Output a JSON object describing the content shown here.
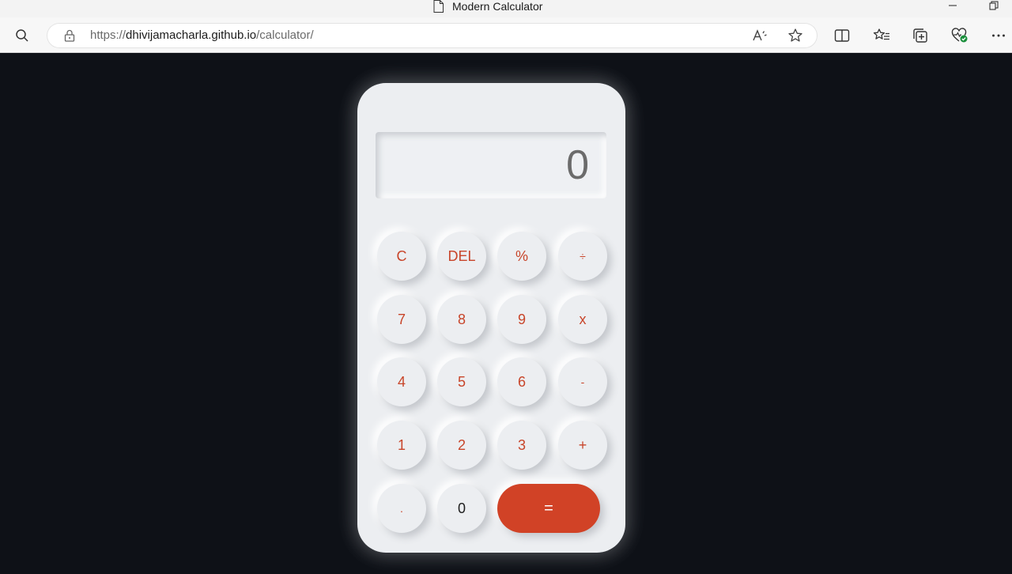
{
  "browser": {
    "tab_title": "Modern Calculator",
    "url_prefix": "https://",
    "url_host": "dhivijamacharla.github.io",
    "url_path": "/calculator/"
  },
  "calculator": {
    "display_value": "0",
    "keys": {
      "clear": "C",
      "delete": "DEL",
      "percent": "%",
      "divide": "÷",
      "seven": "7",
      "eight": "8",
      "nine": "9",
      "multiply": "x",
      "four": "4",
      "five": "5",
      "six": "6",
      "subtract": "-",
      "one": "1",
      "two": "2",
      "three": "3",
      "add": "+",
      "decimal": ".",
      "zero": "0",
      "equals": "="
    },
    "colors": {
      "accent": "#d14226",
      "key_text": "#c8452a",
      "body": "#eceef1",
      "page_background": "#0e1117"
    }
  }
}
